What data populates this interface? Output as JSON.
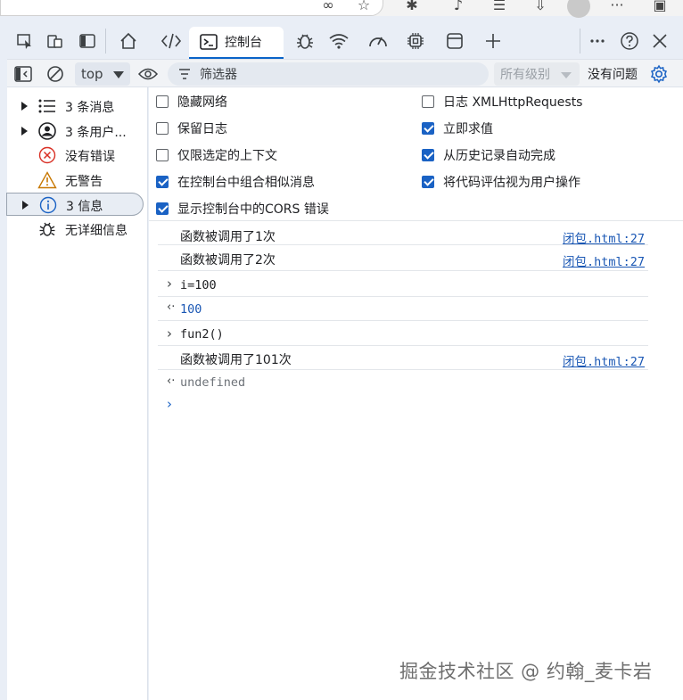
{
  "tabs": {
    "active_label": "控制台"
  },
  "toolbar": {
    "context": "top",
    "filter_placeholder": "筛选器",
    "levels": "所有级别",
    "issues": "没有问题"
  },
  "sidebar": {
    "items": [
      {
        "label": "3 条消息",
        "expandable": true
      },
      {
        "label": "3 条用户...",
        "expandable": true
      },
      {
        "label": "没有错误",
        "expandable": false
      },
      {
        "label": "无警告",
        "expandable": false
      },
      {
        "label": "3 信息",
        "expandable": true,
        "selected": true
      },
      {
        "label": "无详细信息",
        "expandable": false
      }
    ]
  },
  "settings": {
    "left": [
      {
        "label": "隐藏网络",
        "checked": false
      },
      {
        "label": "保留日志",
        "checked": false
      },
      {
        "label": "仅限选定的上下文",
        "checked": false
      },
      {
        "label": "在控制台中组合相似消息",
        "checked": true
      },
      {
        "label": "显示控制台中的CORS 错误",
        "checked": true
      }
    ],
    "right": [
      {
        "label": "日志 XMLHttpRequests",
        "checked": false
      },
      {
        "label": "立即求值",
        "checked": true
      },
      {
        "label": "从历史记录自动完成",
        "checked": true
      },
      {
        "label": "将代码评估视为用户操作",
        "checked": true
      }
    ]
  },
  "console": {
    "rows": [
      {
        "kind": "log",
        "text": "函数被调用了1次",
        "source": "闭包.html:27"
      },
      {
        "kind": "log",
        "text": "函数被调用了2次",
        "source": "闭包.html:27"
      },
      {
        "kind": "input",
        "text": "i=100"
      },
      {
        "kind": "result",
        "text": "100"
      },
      {
        "kind": "input",
        "text": "fun2()"
      },
      {
        "kind": "log",
        "text": "函数被调用了101次",
        "source": "闭包.html:27"
      },
      {
        "kind": "result",
        "text": "undefined"
      }
    ]
  },
  "watermark": "掘金技术社区 @ 约翰_麦卡岩"
}
